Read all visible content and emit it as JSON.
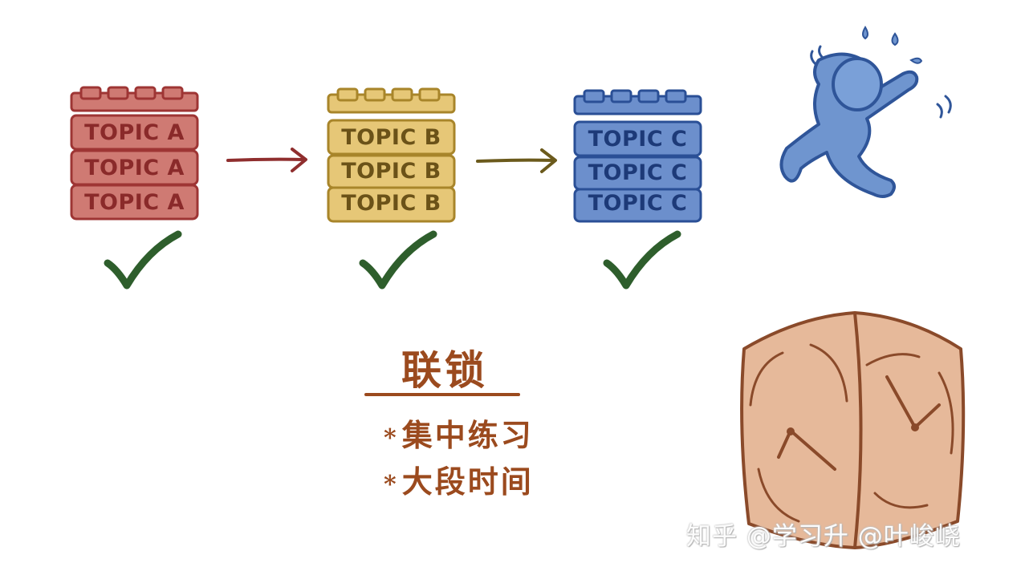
{
  "stacks": [
    {
      "id": "a",
      "labels": [
        "TOPIC A",
        "TOPIC A",
        "TOPIC A"
      ],
      "fill": "#cf7a73",
      "stroke": "#9e3534",
      "text": "#8a2a2a"
    },
    {
      "id": "b",
      "labels": [
        "TOPIC B",
        "TOPIC B",
        "TOPIC B"
      ],
      "fill": "#e6c777",
      "stroke": "#a8852a",
      "text": "#6b5218"
    },
    {
      "id": "c",
      "labels": [
        "TOPIC C",
        "TOPIC C",
        "TOPIC C"
      ],
      "fill": "#6c8fcc",
      "stroke": "#2a4f96",
      "text": "#1d3a78"
    }
  ],
  "colors": {
    "arrow1": "#8f2e2e",
    "arrow2": "#6b5a1c",
    "check": "#2e5e2c",
    "runner": "#6f95cf",
    "runner_stroke": "#2f5599",
    "clock_fill": "#e6b99a",
    "clock_stroke": "#8a4a2a",
    "title": "#9b4a1e"
  },
  "icons": [
    "arrow-right-icon",
    "checkmark-icon",
    "running-person-icon",
    "clock-block-icon"
  ],
  "heading": "联锁",
  "bullets": [
    "集中练习",
    "大段时间"
  ],
  "bullet_mark": "*",
  "watermark": "知乎 @学习升 @叶峻峣"
}
